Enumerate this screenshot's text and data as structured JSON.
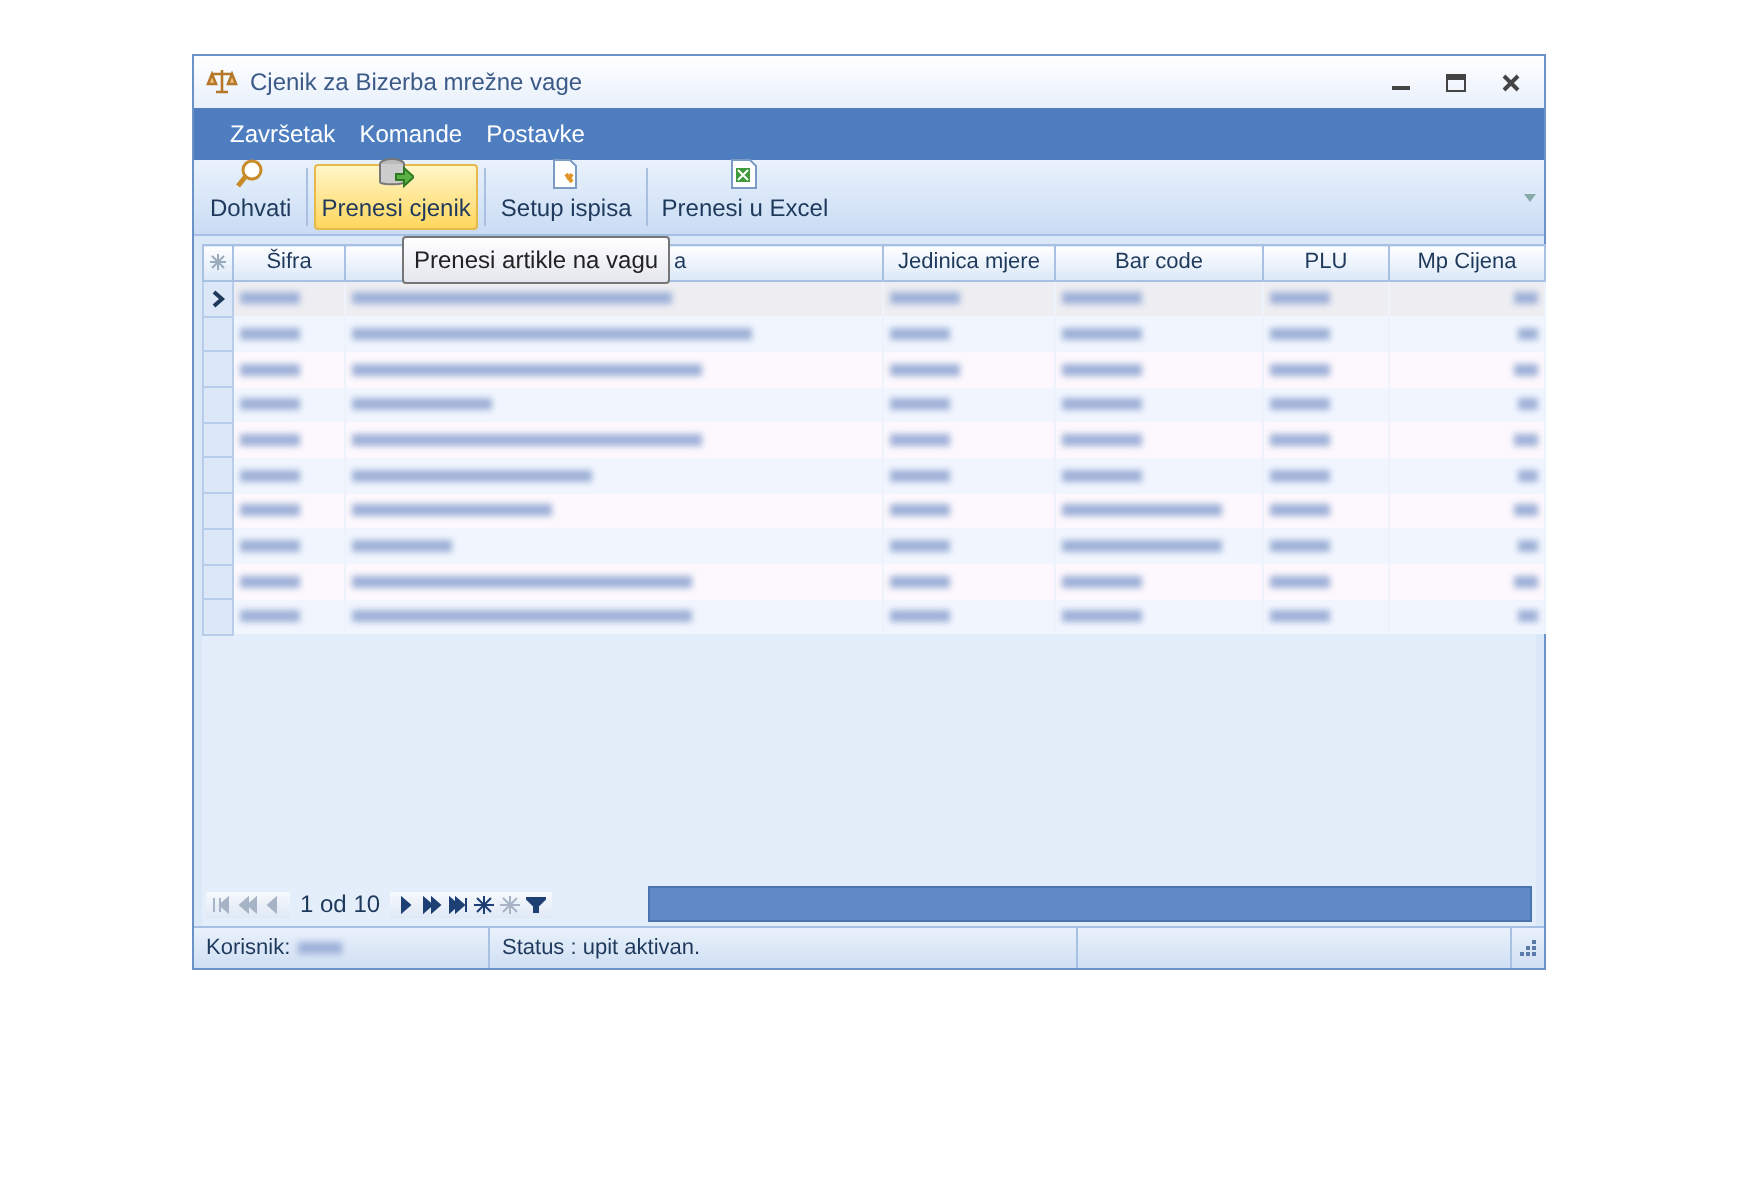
{
  "window": {
    "title": "Cjenik za Bizerba mrežne vage"
  },
  "menu": [
    "Završetak",
    "Komande",
    "Postavke"
  ],
  "toolbar": [
    {
      "label": "Dohvati",
      "kind": "search",
      "selected": false
    },
    {
      "label": "Prenesi cjenik",
      "kind": "database",
      "selected": true
    },
    {
      "label": "Setup ispisa",
      "kind": "page-setup",
      "selected": false
    },
    {
      "label": "Prenesi u Excel",
      "kind": "excel",
      "selected": false
    }
  ],
  "tooltip": "Prenesi artikle na vagu",
  "table": {
    "columns": [
      "Šifra",
      "a",
      "Jedinica mjere",
      "Bar code",
      "PLU",
      "Mp Cijena"
    ],
    "rows": [
      {
        "selected": true
      },
      {
        "selected": false
      },
      {
        "selected": false
      },
      {
        "selected": false
      },
      {
        "selected": false
      },
      {
        "selected": false
      },
      {
        "selected": false
      },
      {
        "selected": false
      },
      {
        "selected": false
      },
      {
        "selected": false
      }
    ]
  },
  "navigator": {
    "buttons": [
      {
        "kind": "first",
        "disabled": true
      },
      {
        "kind": "prev-page",
        "disabled": true
      },
      {
        "kind": "prev",
        "disabled": true
      }
    ],
    "position": "1 od 10",
    "buttons_after": [
      {
        "kind": "next",
        "disabled": false
      },
      {
        "kind": "next-page",
        "disabled": false
      },
      {
        "kind": "last",
        "disabled": false
      },
      {
        "kind": "add",
        "disabled": false
      },
      {
        "kind": "delete",
        "disabled": true
      },
      {
        "kind": "filter",
        "disabled": false
      }
    ]
  },
  "status_bar": {
    "user_label": "Korisnik:",
    "status": "Status : upit aktivan."
  }
}
